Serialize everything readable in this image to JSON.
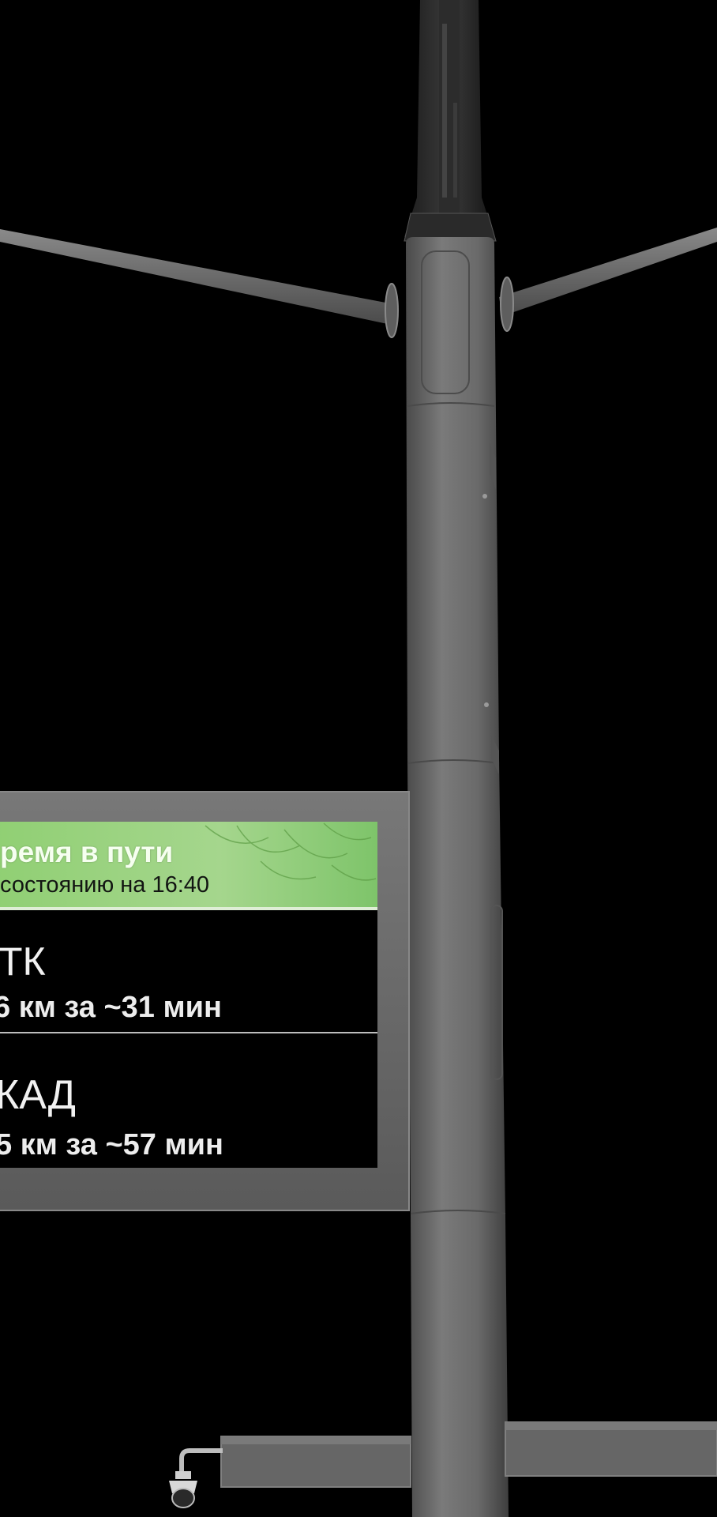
{
  "sign": {
    "header_title": "ремя в пути",
    "header_subtitle": "состоянию на 16:40",
    "route_1_name": "ТК",
    "route_1_detail": "6 км за ~31 мин",
    "route_2_name": "КАД",
    "route_2_detail": "5 км за ~57 мин"
  },
  "colors": {
    "background": "#000000",
    "pole": "#6a6a6a",
    "sign_frame": "#6b6b6b",
    "sign_screen": "#000000",
    "header_green": "#a6d48c"
  }
}
